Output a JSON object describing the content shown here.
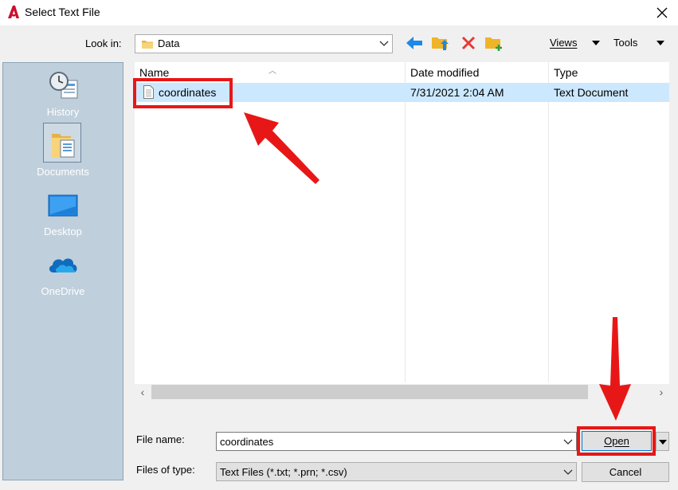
{
  "window": {
    "title": "Select Text File"
  },
  "toolbar": {
    "look_in_label": "Look in:",
    "look_in_value": "Data",
    "views_label": "Views",
    "tools_label": "Tools"
  },
  "places": [
    {
      "label": "History",
      "icon": "history-icon"
    },
    {
      "label": "Documents",
      "icon": "documents-icon"
    },
    {
      "label": "Desktop",
      "icon": "desktop-icon"
    },
    {
      "label": "OneDrive",
      "icon": "onedrive-icon"
    }
  ],
  "file_list": {
    "columns": [
      "Name",
      "Date modified",
      "Type"
    ],
    "rows": [
      {
        "name": "coordinates",
        "date_modified": "7/31/2021 2:04 AM",
        "type": "Text Document"
      }
    ]
  },
  "bottom": {
    "file_name_label": "File name:",
    "file_name_value": "coordinates",
    "files_of_type_label": "Files of type:",
    "files_of_type_value": "Text Files (*.txt; *.prn; *.csv)",
    "open_label": "Open",
    "cancel_label": "Cancel"
  },
  "colors": {
    "highlight": "#e81717",
    "selection": "#cce8ff",
    "places_bg": "#bfcfdc",
    "accent_blue": "#0078d7"
  }
}
